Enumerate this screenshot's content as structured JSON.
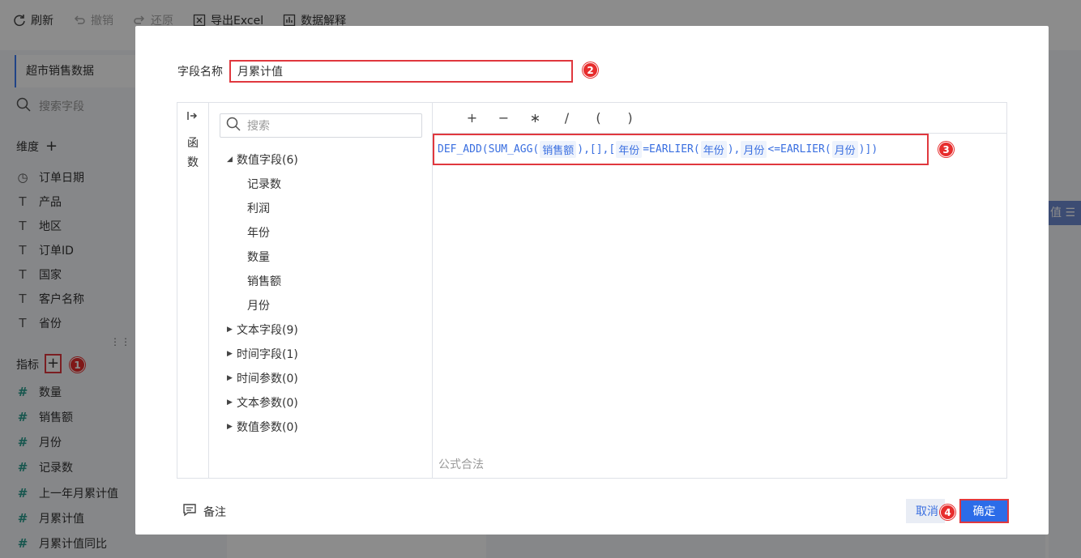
{
  "toolbar": {
    "refresh": "刷新",
    "undo": "撤销",
    "redo": "还原",
    "export": "导出Excel",
    "explain": "数据解释"
  },
  "sidebar": {
    "dataset_name": "超市销售数据",
    "search_placeholder": "搜索字段",
    "dimensions_title": "维度",
    "dimensions": [
      {
        "icon": "clock-icon",
        "label": "订单日期"
      },
      {
        "icon": "text-type-icon",
        "label": "产品"
      },
      {
        "icon": "text-type-icon",
        "label": "地区"
      },
      {
        "icon": "text-type-icon",
        "label": "订单ID"
      },
      {
        "icon": "text-type-icon",
        "label": "国家"
      },
      {
        "icon": "text-type-icon",
        "label": "客户名称"
      },
      {
        "icon": "text-type-icon",
        "label": "省份"
      }
    ],
    "metrics_title": "指标",
    "metrics": [
      {
        "icon": "number-type-icon",
        "label": "数量"
      },
      {
        "icon": "number-type-icon",
        "label": "销售额"
      },
      {
        "icon": "number-type-icon",
        "label": "月份"
      },
      {
        "icon": "number-count-icon",
        "label": "记录数"
      },
      {
        "icon": "calc-field-icon",
        "label": "上一年月累计值"
      },
      {
        "icon": "calc-field-icon",
        "label": "月累计值"
      },
      {
        "icon": "calc-field-icon",
        "label": "月累计值同比"
      }
    ]
  },
  "background": {
    "right_strip_text": "值 ☰"
  },
  "modal": {
    "field_name_label": "字段名称",
    "field_name_value": "月累计值",
    "func_label": "函数",
    "tree_search_placeholder": "搜索",
    "tree": {
      "numeric_group": "数值字段(6)",
      "numeric_fields": [
        "记录数",
        "利润",
        "年份",
        "数量",
        "销售额",
        "月份"
      ],
      "collapsed_groups": [
        "文本字段(9)",
        "时间字段(1)",
        "时间参数(0)",
        "文本参数(0)",
        "数值参数(0)"
      ]
    },
    "operators": [
      "+",
      "−",
      "∗",
      "/",
      "(",
      ")"
    ],
    "formula": {
      "p1": "DEF_ADD(SUM_AGG(",
      "t1": "销售额",
      "p2": "),[],[",
      "t2": "年份",
      "p3": "=EARLIER(",
      "t3": "年份",
      "p4": "),",
      "t4": "月份",
      "p5": "<=EARLIER(",
      "t5": "月份",
      "p6": ")])"
    },
    "validation": "公式合法",
    "remark": "备注",
    "cancel": "取消",
    "ok": "确定"
  },
  "badges": [
    "1",
    "2",
    "3",
    "4"
  ],
  "colors": {
    "accent": "#2c6ce8",
    "highlight_border": "#e0383e",
    "badge": "#e72d2d"
  }
}
